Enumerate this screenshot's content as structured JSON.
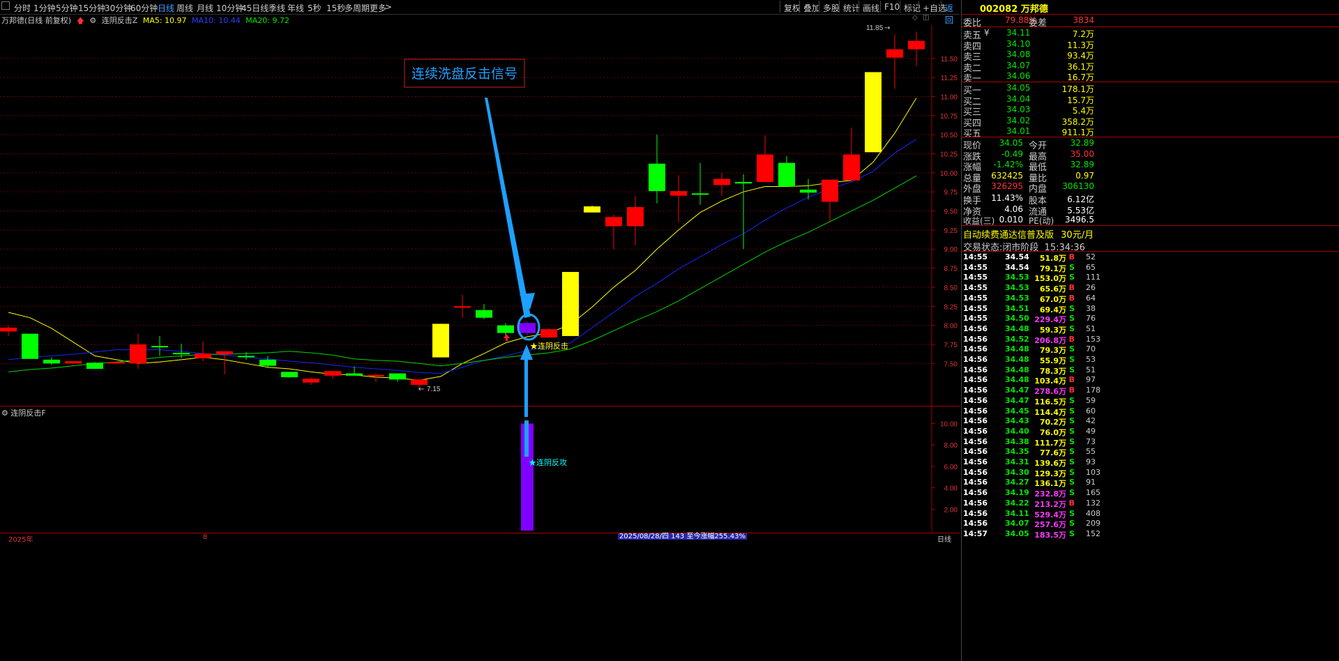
{
  "toolbar": {
    "tabs": [
      "分时",
      "1分钟",
      "5分钟",
      "15分钟",
      "30分钟",
      "60分钟",
      "日线",
      "周线",
      "月线",
      "10分钟",
      "45日线",
      "季线",
      "年线",
      "5秒",
      "15秒",
      "多周期",
      "更多"
    ],
    "active_tab": "日线",
    "right_buttons": [
      "复权",
      "叠加",
      "多股",
      "统计",
      "画线",
      "F10",
      "标记",
      "+自选",
      "返回"
    ]
  },
  "info": {
    "stock": "万邦德(日线 前复权)",
    "indicator": "连阴反击Z",
    "ma5": "MA5: 10.97",
    "ma10": "MA10: 10.44",
    "ma20": "MA20: 9.72"
  },
  "main": {
    "annotation_box": "连续洗盘反击信号",
    "signal_label": "★连阴反击",
    "high_label": "11.85",
    "low_label": "7.15",
    "y_ticks": [
      "11.50",
      "11.25",
      "11.00",
      "10.75",
      "10.50",
      "10.25",
      "10.00",
      "9.75",
      "9.50",
      "9.25",
      "9.00",
      "8.75",
      "8.50",
      "8.25",
      "8.00",
      "7.75",
      "7.50"
    ]
  },
  "sub": {
    "title": "连阴反击F",
    "signal_label": "★连阴反攻",
    "y_ticks": [
      "10.00",
      "8.00",
      "6.00",
      "4.00",
      "2.00"
    ]
  },
  "bottom": {
    "year": "2025年",
    "month": "8",
    "status": "2025/08/28/四 143 至今涨幅255.43%",
    "period": "日线"
  },
  "colors": {
    "up": "#ff0000",
    "down": "#00ff00",
    "ma5": "#ffff00",
    "ma10": "#1428ff",
    "ma20": "#00d800",
    "signal": "#8000ff",
    "annotation": "#1ea0ff"
  },
  "chart_data": {
    "type": "candlestick",
    "candles": [
      {
        "o": 7.97,
        "c": 7.92,
        "h": 8.0,
        "l": 7.86,
        "type": "up"
      },
      {
        "o": 7.89,
        "c": 7.56,
        "h": 7.89,
        "l": 7.56,
        "type": "down"
      },
      {
        "o": 7.55,
        "c": 7.5,
        "h": 7.58,
        "l": 7.48,
        "type": "down"
      },
      {
        "o": 7.53,
        "c": 7.5,
        "h": 7.53,
        "l": 7.5,
        "type": "up"
      },
      {
        "o": 7.51,
        "c": 7.43,
        "h": 7.52,
        "l": 7.43,
        "type": "down"
      },
      {
        "o": 7.52,
        "c": 7.5,
        "h": 7.52,
        "l": 7.49,
        "type": "up"
      },
      {
        "o": 7.75,
        "c": 7.5,
        "h": 7.89,
        "l": 7.43,
        "type": "up"
      },
      {
        "o": 7.73,
        "c": 7.72,
        "h": 7.86,
        "l": 7.6,
        "type": "down"
      },
      {
        "o": 7.64,
        "c": 7.62,
        "h": 7.76,
        "l": 7.57,
        "type": "down"
      },
      {
        "o": 7.63,
        "c": 7.57,
        "h": 7.79,
        "l": 7.53,
        "type": "up"
      },
      {
        "o": 7.66,
        "c": 7.62,
        "h": 7.66,
        "l": 7.36,
        "type": "up"
      },
      {
        "o": 7.6,
        "c": 7.59,
        "h": 7.65,
        "l": 7.55,
        "type": "down"
      },
      {
        "o": 7.55,
        "c": 7.47,
        "h": 7.6,
        "l": 7.44,
        "type": "down"
      },
      {
        "o": 7.39,
        "c": 7.32,
        "h": 7.39,
        "l": 7.31,
        "type": "down"
      },
      {
        "o": 7.3,
        "c": 7.25,
        "h": 7.32,
        "l": 7.22,
        "type": "up"
      },
      {
        "o": 7.4,
        "c": 7.34,
        "h": 7.4,
        "l": 7.3,
        "type": "up"
      },
      {
        "o": 7.37,
        "c": 7.34,
        "h": 7.46,
        "l": 7.34,
        "type": "down"
      },
      {
        "o": 7.35,
        "c": 7.35,
        "h": 7.37,
        "l": 7.26,
        "type": "up"
      },
      {
        "o": 7.37,
        "c": 7.29,
        "h": 7.37,
        "l": 7.26,
        "type": "down"
      },
      {
        "o": 7.29,
        "c": 7.22,
        "h": 7.3,
        "l": 7.15,
        "type": "up"
      },
      {
        "o": 7.58,
        "c": 8.02,
        "h": 8.02,
        "l": 7.58,
        "type": "yellow"
      },
      {
        "o": 8.25,
        "c": 8.25,
        "h": 8.4,
        "l": 8.1,
        "type": "up"
      },
      {
        "o": 8.1,
        "c": 8.2,
        "h": 8.28,
        "l": 8.08,
        "type": "down"
      },
      {
        "o": 7.9,
        "c": 8.0,
        "h": 8.03,
        "l": 7.85,
        "type": "down"
      },
      {
        "o": 7.9,
        "c": 8.03,
        "h": 8.05,
        "l": 7.87,
        "type": "signal"
      },
      {
        "o": 7.84,
        "c": 7.95,
        "h": 7.96,
        "l": 7.84,
        "type": "up"
      },
      {
        "o": 7.86,
        "c": 8.7,
        "h": 8.7,
        "l": 7.86,
        "type": "yellow"
      },
      {
        "o": 9.48,
        "c": 9.56,
        "h": 9.57,
        "l": 9.48,
        "type": "yellow"
      },
      {
        "o": 9.3,
        "c": 9.42,
        "h": 9.45,
        "l": 9.0,
        "type": "up"
      },
      {
        "o": 9.3,
        "c": 9.55,
        "h": 9.7,
        "l": 9.05,
        "type": "up"
      },
      {
        "o": 9.76,
        "c": 10.12,
        "h": 10.5,
        "l": 9.6,
        "type": "down"
      },
      {
        "o": 9.7,
        "c": 9.76,
        "h": 9.97,
        "l": 9.35,
        "type": "up"
      },
      {
        "o": 9.73,
        "c": 9.72,
        "h": 10.13,
        "l": 9.58,
        "type": "down"
      },
      {
        "o": 9.84,
        "c": 9.92,
        "h": 10.0,
        "l": 9.7,
        "type": "up"
      },
      {
        "o": 9.88,
        "c": 9.86,
        "h": 9.98,
        "l": 9.0,
        "type": "down"
      },
      {
        "o": 9.88,
        "c": 10.24,
        "h": 10.49,
        "l": 9.88,
        "type": "up"
      },
      {
        "o": 9.82,
        "c": 10.13,
        "h": 10.22,
        "l": 9.82,
        "type": "down"
      },
      {
        "o": 9.78,
        "c": 9.74,
        "h": 9.92,
        "l": 9.65,
        "type": "down"
      },
      {
        "o": 9.62,
        "c": 9.91,
        "h": 9.91,
        "l": 9.35,
        "type": "up"
      },
      {
        "o": 9.9,
        "c": 10.24,
        "h": 10.59,
        "l": 9.88,
        "type": "up"
      },
      {
        "o": 10.27,
        "c": 11.32,
        "h": 11.32,
        "l": 10.27,
        "type": "yellow"
      },
      {
        "o": 11.51,
        "c": 11.62,
        "h": 11.82,
        "l": 11.1,
        "type": "up"
      },
      {
        "o": 11.62,
        "c": 11.73,
        "h": 11.85,
        "l": 11.4,
        "type": "up"
      }
    ],
    "ma5": [
      8.17,
      8.1,
      7.96,
      7.78,
      7.6,
      7.55,
      7.5,
      7.52,
      7.55,
      7.58,
      7.55,
      7.5,
      7.45,
      7.43,
      7.39,
      7.36,
      7.35,
      7.32,
      7.31,
      7.28,
      7.33,
      7.5,
      7.63,
      7.77,
      7.85,
      7.9,
      8.01,
      8.24,
      8.5,
      8.72,
      9.0,
      9.25,
      9.48,
      9.63,
      9.75,
      9.82,
      9.82,
      9.83,
      9.87,
      9.9,
      10.14,
      10.52,
      10.98
    ],
    "ma10": [
      7.55,
      7.58,
      7.6,
      7.62,
      7.65,
      7.68,
      7.68,
      7.68,
      7.66,
      7.63,
      7.61,
      7.58,
      7.56,
      7.53,
      7.51,
      7.48,
      7.45,
      7.43,
      7.41,
      7.38,
      7.37,
      7.45,
      7.54,
      7.6,
      7.67,
      7.72,
      7.77,
      7.97,
      8.17,
      8.38,
      8.55,
      8.74,
      8.9,
      9.06,
      9.2,
      9.38,
      9.54,
      9.68,
      9.79,
      9.88,
      10.02,
      10.26,
      10.44
    ],
    "ma20": [
      7.39,
      7.42,
      7.44,
      7.47,
      7.5,
      7.52,
      7.55,
      7.58,
      7.6,
      7.62,
      7.62,
      7.63,
      7.64,
      7.66,
      7.64,
      7.61,
      7.56,
      7.54,
      7.53,
      7.5,
      7.47,
      7.5,
      7.54,
      7.58,
      7.61,
      7.64,
      7.69,
      7.8,
      7.93,
      8.06,
      8.18,
      8.32,
      8.48,
      8.64,
      8.8,
      8.96,
      9.1,
      9.22,
      9.36,
      9.5,
      9.64,
      9.8,
      9.96
    ],
    "ylim": [
      7.0,
      11.9
    ],
    "sub_values": [
      0,
      0,
      0,
      0,
      0,
      0,
      0,
      0,
      0,
      0,
      0,
      0,
      0,
      0,
      0,
      0,
      0,
      0,
      0,
      0,
      0,
      0,
      0,
      0,
      10,
      0,
      0,
      0,
      0,
      0,
      0,
      0,
      0,
      0,
      0,
      0,
      0,
      0,
      0,
      0,
      0,
      0,
      0
    ],
    "sub_ylim": [
      0,
      11.2
    ]
  },
  "quote": {
    "code": "002082",
    "name": "万邦德",
    "weibi_label": "委比",
    "weibi": "79.88%",
    "weicha_label": "委差",
    "weicha": "3834",
    "sells": [
      {
        "label": "卖五",
        "price": "34.11",
        "vol": "7.2万",
        "mark": "¥"
      },
      {
        "label": "卖四",
        "price": "34.10",
        "vol": "11.3万",
        "mark": ""
      },
      {
        "label": "卖三",
        "price": "34.08",
        "vol": "93.4万",
        "mark": ""
      },
      {
        "label": "卖二",
        "price": "34.07",
        "vol": "36.1万",
        "mark": ""
      },
      {
        "label": "卖一",
        "price": "34.06",
        "vol": "16.7万",
        "mark": ""
      }
    ],
    "buys": [
      {
        "label": "买一",
        "price": "34.05",
        "vol": "178.1万"
      },
      {
        "label": "买二",
        "price": "34.04",
        "vol": "15.7万"
      },
      {
        "label": "买三",
        "price": "34.03",
        "vol": "5.4万"
      },
      {
        "label": "买四",
        "price": "34.02",
        "vol": "358.2万"
      },
      {
        "label": "买五",
        "price": "34.01",
        "vol": "911.1万"
      }
    ],
    "stats": [
      {
        "l1": "现价",
        "v1": "34.05",
        "c1": "green",
        "l2": "今开",
        "v2": "32.89",
        "c2": "green"
      },
      {
        "l1": "涨跌",
        "v1": "-0.49",
        "c1": "green",
        "l2": "最高",
        "v2": "35.00",
        "c2": "red"
      },
      {
        "l1": "涨幅",
        "v1": "-1.42%",
        "c1": "green",
        "l2": "最低",
        "v2": "32.89",
        "c2": "green"
      },
      {
        "l1": "总量",
        "v1": "632425",
        "c1": "yellow",
        "l2": "量比",
        "v2": "0.97",
        "c2": "yellow"
      },
      {
        "l1": "外盘",
        "v1": "326295",
        "c1": "red",
        "l2": "内盘",
        "v2": "306130",
        "c2": "green"
      },
      {
        "l1": "换手",
        "v1": "11.43%",
        "c1": "white",
        "l2": "股本",
        "v2": "6.12亿",
        "c2": "white"
      },
      {
        "l1": "净资",
        "v1": "4.06",
        "c1": "white",
        "l2": "流通",
        "v2": "5.53亿",
        "c2": "white"
      },
      {
        "l1": "收益(三)",
        "v1": "0.010",
        "c1": "white",
        "l2": "PE(动)",
        "v2": "3496.5",
        "c2": "white"
      }
    ],
    "ad": "自动续费通达信普及版",
    "ad_price": "30元/月",
    "trade_state_label": "交易状态:",
    "trade_state": "闭市阶段",
    "trade_time": "15:34:36"
  },
  "ticks": [
    {
      "t": "14:55",
      "p": "34.54",
      "pc": "white",
      "v": "51.8万",
      "vc": "yellow",
      "s": "B",
      "n": "52"
    },
    {
      "t": "14:55",
      "p": "34.54",
      "pc": "white",
      "v": "79.1万",
      "vc": "yellow",
      "s": "S",
      "n": "65"
    },
    {
      "t": "14:55",
      "p": "34.53",
      "pc": "green",
      "v": "153.0万",
      "vc": "yellow",
      "s": "S",
      "n": "111"
    },
    {
      "t": "14:55",
      "p": "34.53",
      "pc": "green",
      "v": "65.6万",
      "vc": "yellow",
      "s": "B",
      "n": "26"
    },
    {
      "t": "14:55",
      "p": "34.53",
      "pc": "green",
      "v": "67.0万",
      "vc": "yellow",
      "s": "B",
      "n": "64"
    },
    {
      "t": "14:55",
      "p": "34.51",
      "pc": "green",
      "v": "69.4万",
      "vc": "yellow",
      "s": "S",
      "n": "38"
    },
    {
      "t": "14:55",
      "p": "34.50",
      "pc": "green",
      "v": "229.4万",
      "vc": "magenta",
      "s": "S",
      "n": "76"
    },
    {
      "t": "14:56",
      "p": "34.48",
      "pc": "green",
      "v": "59.3万",
      "vc": "yellow",
      "s": "S",
      "n": "51"
    },
    {
      "t": "14:56",
      "p": "34.52",
      "pc": "green",
      "v": "206.8万",
      "vc": "magenta",
      "s": "B",
      "n": "153"
    },
    {
      "t": "14:56",
      "p": "34.48",
      "pc": "green",
      "v": "79.3万",
      "vc": "yellow",
      "s": "S",
      "n": "70"
    },
    {
      "t": "14:56",
      "p": "34.48",
      "pc": "green",
      "v": "55.9万",
      "vc": "yellow",
      "s": "S",
      "n": "53"
    },
    {
      "t": "14:56",
      "p": "34.48",
      "pc": "green",
      "v": "78.3万",
      "vc": "yellow",
      "s": "S",
      "n": "51"
    },
    {
      "t": "14:56",
      "p": "34.48",
      "pc": "green",
      "v": "103.4万",
      "vc": "yellow",
      "s": "B",
      "n": "97"
    },
    {
      "t": "14:56",
      "p": "34.47",
      "pc": "green",
      "v": "278.6万",
      "vc": "magenta",
      "s": "B",
      "n": "178"
    },
    {
      "t": "14:56",
      "p": "34.47",
      "pc": "green",
      "v": "116.5万",
      "vc": "yellow",
      "s": "S",
      "n": "59"
    },
    {
      "t": "14:56",
      "p": "34.45",
      "pc": "green",
      "v": "114.4万",
      "vc": "yellow",
      "s": "S",
      "n": "60"
    },
    {
      "t": "14:56",
      "p": "34.43",
      "pc": "green",
      "v": "70.2万",
      "vc": "yellow",
      "s": "S",
      "n": "42"
    },
    {
      "t": "14:56",
      "p": "34.40",
      "pc": "green",
      "v": "76.0万",
      "vc": "yellow",
      "s": "S",
      "n": "49"
    },
    {
      "t": "14:56",
      "p": "34.38",
      "pc": "green",
      "v": "111.7万",
      "vc": "yellow",
      "s": "S",
      "n": "73"
    },
    {
      "t": "14:56",
      "p": "34.35",
      "pc": "green",
      "v": "77.6万",
      "vc": "yellow",
      "s": "S",
      "n": "55"
    },
    {
      "t": "14:56",
      "p": "34.31",
      "pc": "green",
      "v": "139.6万",
      "vc": "yellow",
      "s": "S",
      "n": "93"
    },
    {
      "t": "14:56",
      "p": "34.30",
      "pc": "green",
      "v": "129.3万",
      "vc": "yellow",
      "s": "S",
      "n": "103"
    },
    {
      "t": "14:56",
      "p": "34.27",
      "pc": "green",
      "v": "136.1万",
      "vc": "yellow",
      "s": "S",
      "n": "91"
    },
    {
      "t": "14:56",
      "p": "34.19",
      "pc": "green",
      "v": "232.8万",
      "vc": "magenta",
      "s": "S",
      "n": "165"
    },
    {
      "t": "14:56",
      "p": "34.22",
      "pc": "green",
      "v": "213.2万",
      "vc": "magenta",
      "s": "B",
      "n": "132"
    },
    {
      "t": "14:56",
      "p": "34.11",
      "pc": "green",
      "v": "529.4万",
      "vc": "magenta",
      "s": "S",
      "n": "408"
    },
    {
      "t": "14:56",
      "p": "34.07",
      "pc": "green",
      "v": "257.6万",
      "vc": "magenta",
      "s": "S",
      "n": "209"
    },
    {
      "t": "14:57",
      "p": "34.05",
      "pc": "green",
      "v": "183.5万",
      "vc": "magenta",
      "s": "S",
      "n": "152"
    }
  ]
}
